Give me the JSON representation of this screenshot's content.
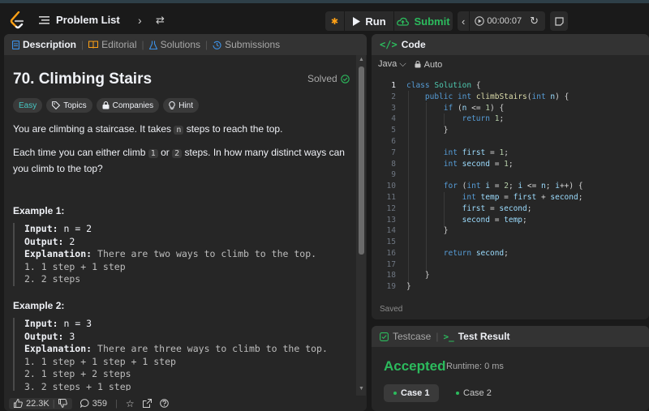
{
  "topbar": {
    "problem_list_label": "Problem List",
    "run_label": "Run",
    "submit_label": "Submit",
    "timer": "00:00:07"
  },
  "left_tabs": [
    {
      "label": "Description",
      "icon": "description-icon",
      "active": true
    },
    {
      "label": "Editorial",
      "icon": "book-icon",
      "active": false
    },
    {
      "label": "Solutions",
      "icon": "flask-icon",
      "active": false
    },
    {
      "label": "Submissions",
      "icon": "history-icon",
      "active": false
    }
  ],
  "problem": {
    "title": "70. Climbing Stairs",
    "status": "Solved",
    "tags": [
      "Easy",
      "Topics",
      "Companies",
      "Hint"
    ],
    "desc1_before": "You are climbing a staircase. It takes ",
    "desc1_code": "n",
    "desc1_after": " steps to reach the top.",
    "desc2_before": "Each time you can either climb ",
    "desc2_code1": "1",
    "desc2_mid": " or ",
    "desc2_code2": "2",
    "desc2_after": " steps. In how many distinct ways can you climb to the top?",
    "example1": {
      "heading": "Example 1:",
      "input_label": "Input:",
      "input": " n = 2",
      "output_label": "Output:",
      "output": " 2",
      "expl_label": "Explanation:",
      "expl": " There are two ways to climb to the top.",
      "lines": [
        "1. 1 step + 1 step",
        "2. 2 steps"
      ]
    },
    "example2": {
      "heading": "Example 2:",
      "input_label": "Input:",
      "input": " n = 3",
      "output_label": "Output:",
      "output": " 3",
      "expl_label": "Explanation:",
      "expl": " There are three ways to climb to the top.",
      "lines": [
        "1. 1 step + 1 step + 1 step",
        "2. 1 step + 2 steps",
        "3. 2 steps + 1 step"
      ]
    }
  },
  "footer": {
    "likes": "22.3K",
    "comments": "359"
  },
  "code_panel": {
    "title": "Code",
    "language": "Java",
    "mode": "Auto",
    "saved": "Saved",
    "line_numbers": [
      "1",
      "2",
      "3",
      "4",
      "5",
      "6",
      "7",
      "8",
      "9",
      "10",
      "11",
      "12",
      "13",
      "14",
      "15",
      "16",
      "17",
      "18",
      "19"
    ]
  },
  "result_panel": {
    "testcase_label": "Testcase",
    "test_result_label": "Test Result",
    "status": "Accepted",
    "runtime": "Runtime: 0 ms",
    "cases": [
      "Case 1",
      "Case 2"
    ]
  },
  "colors": {
    "accent_orange": "#ffa116",
    "success_green": "#2cbb5d",
    "easy_teal": "#46c6c2"
  }
}
